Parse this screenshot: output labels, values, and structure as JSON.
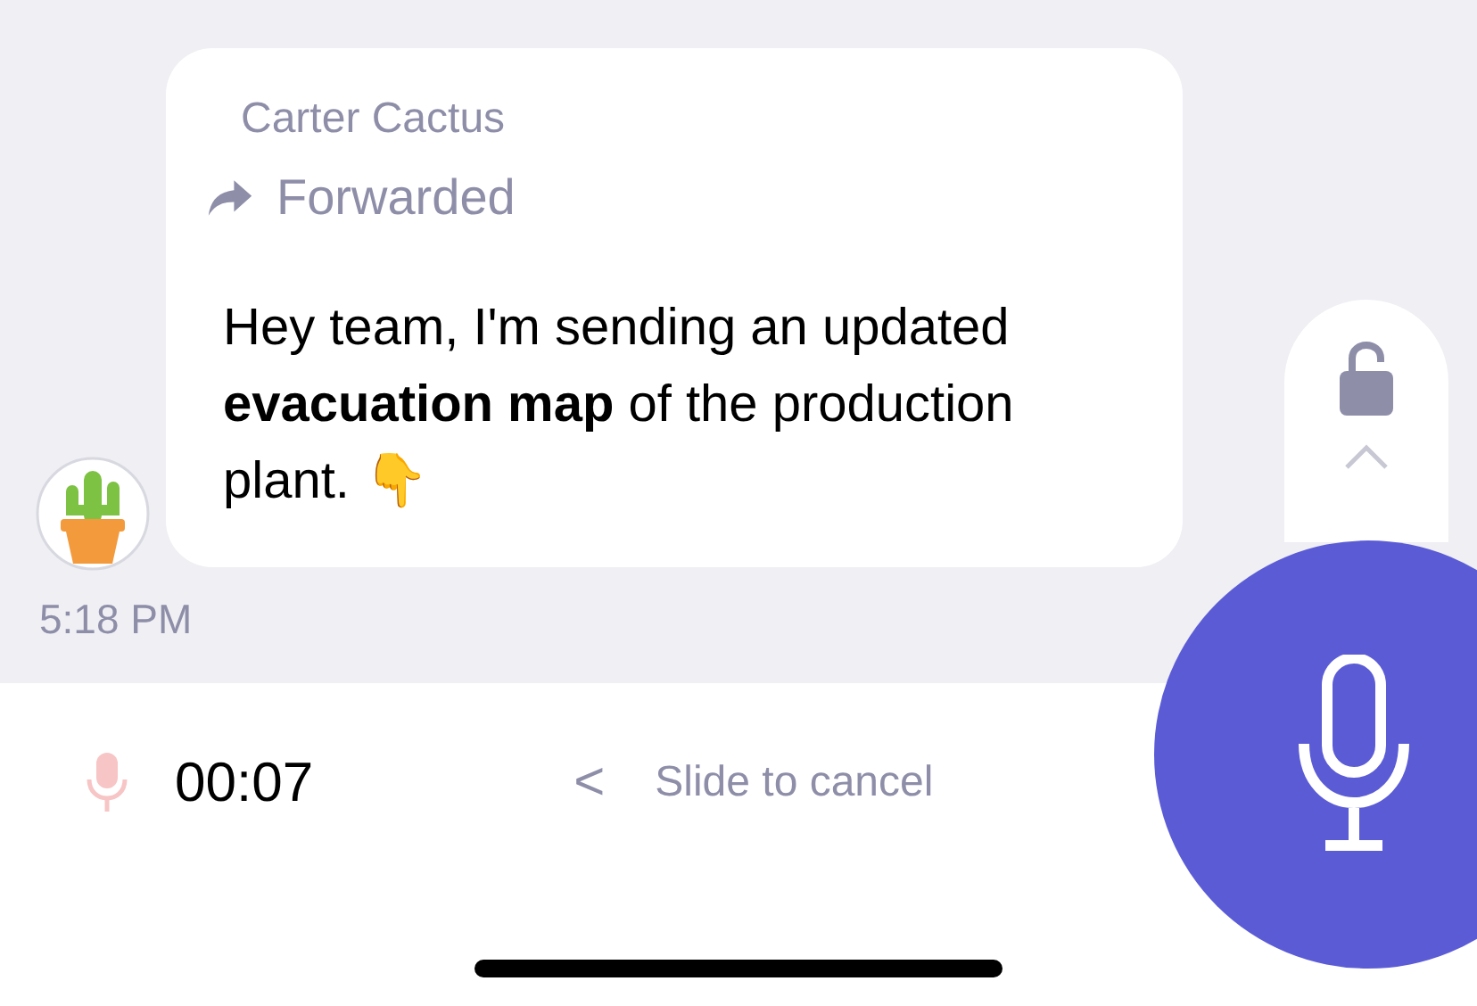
{
  "message": {
    "sender": "Carter Cactus",
    "forwarded_label": "Forwarded",
    "text": "Hey team, I'm sending an updated **evacuation map** of the production plant. 👇",
    "time": "5:18 PM"
  },
  "recording": {
    "duration": "00:07",
    "chevron": "<",
    "hint": "Slide to cancel"
  }
}
